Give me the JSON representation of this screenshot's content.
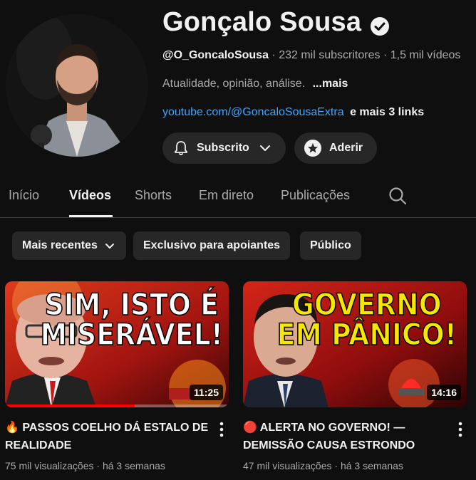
{
  "channel": {
    "name": "Gonçalo Sousa",
    "handle": "@O_GoncaloSousa",
    "subscribers": "232 mil subscritores",
    "video_count": "1,5 mil vídeos",
    "separator": "·",
    "description": "Atualidade, opinião, análise.",
    "more": "...mais",
    "link": "youtube.com/@GoncaloSousaExtra",
    "more_links": "e mais 3 links"
  },
  "buttons": {
    "subscribed": "Subscrito",
    "join": "Aderir"
  },
  "tabs": [
    {
      "label": "Início",
      "active": false
    },
    {
      "label": "Vídeos",
      "active": true
    },
    {
      "label": "Shorts",
      "active": false
    },
    {
      "label": "Em direto",
      "active": false
    },
    {
      "label": "Publicações",
      "active": false
    }
  ],
  "filters": [
    {
      "label": "Mais recentes",
      "has_dropdown": true
    },
    {
      "label": "Exclusivo para apoiantes",
      "has_dropdown": false
    },
    {
      "label": "Público",
      "has_dropdown": false
    }
  ],
  "videos": [
    {
      "title": "🔥 PASSOS COELHO DÁ ESTALO DE REALIDADE",
      "thumb_line1": "SIM, ISTO É",
      "thumb_line2": "MISERÁVEL!",
      "thumb_text_color": "#ffffff",
      "duration": "11:25",
      "views": "75 mil visualizações",
      "age": "há 3 semanas",
      "watched_fraction": 0.58
    },
    {
      "title": "🔴 ALERTA NO GOVERNO! — DEMISSÃO CAUSA ESTRONDO",
      "thumb_line1": "GOVERNO",
      "thumb_line2": "EM PÂNICO!",
      "thumb_text_color": "#f6e600",
      "duration": "14:16",
      "views": "47 mil visualizações",
      "age": "há 3 semanas",
      "watched_fraction": 0
    }
  ],
  "colors": {
    "background": "#0f0f0f",
    "surface": "#272727",
    "link": "#3ea6ff",
    "muted": "#aaaaaa",
    "progress": "#ff0000"
  },
  "icons": [
    "verified-icon",
    "bell-icon",
    "chevron-down-icon",
    "star-icon",
    "search-icon",
    "more-vert-icon"
  ]
}
